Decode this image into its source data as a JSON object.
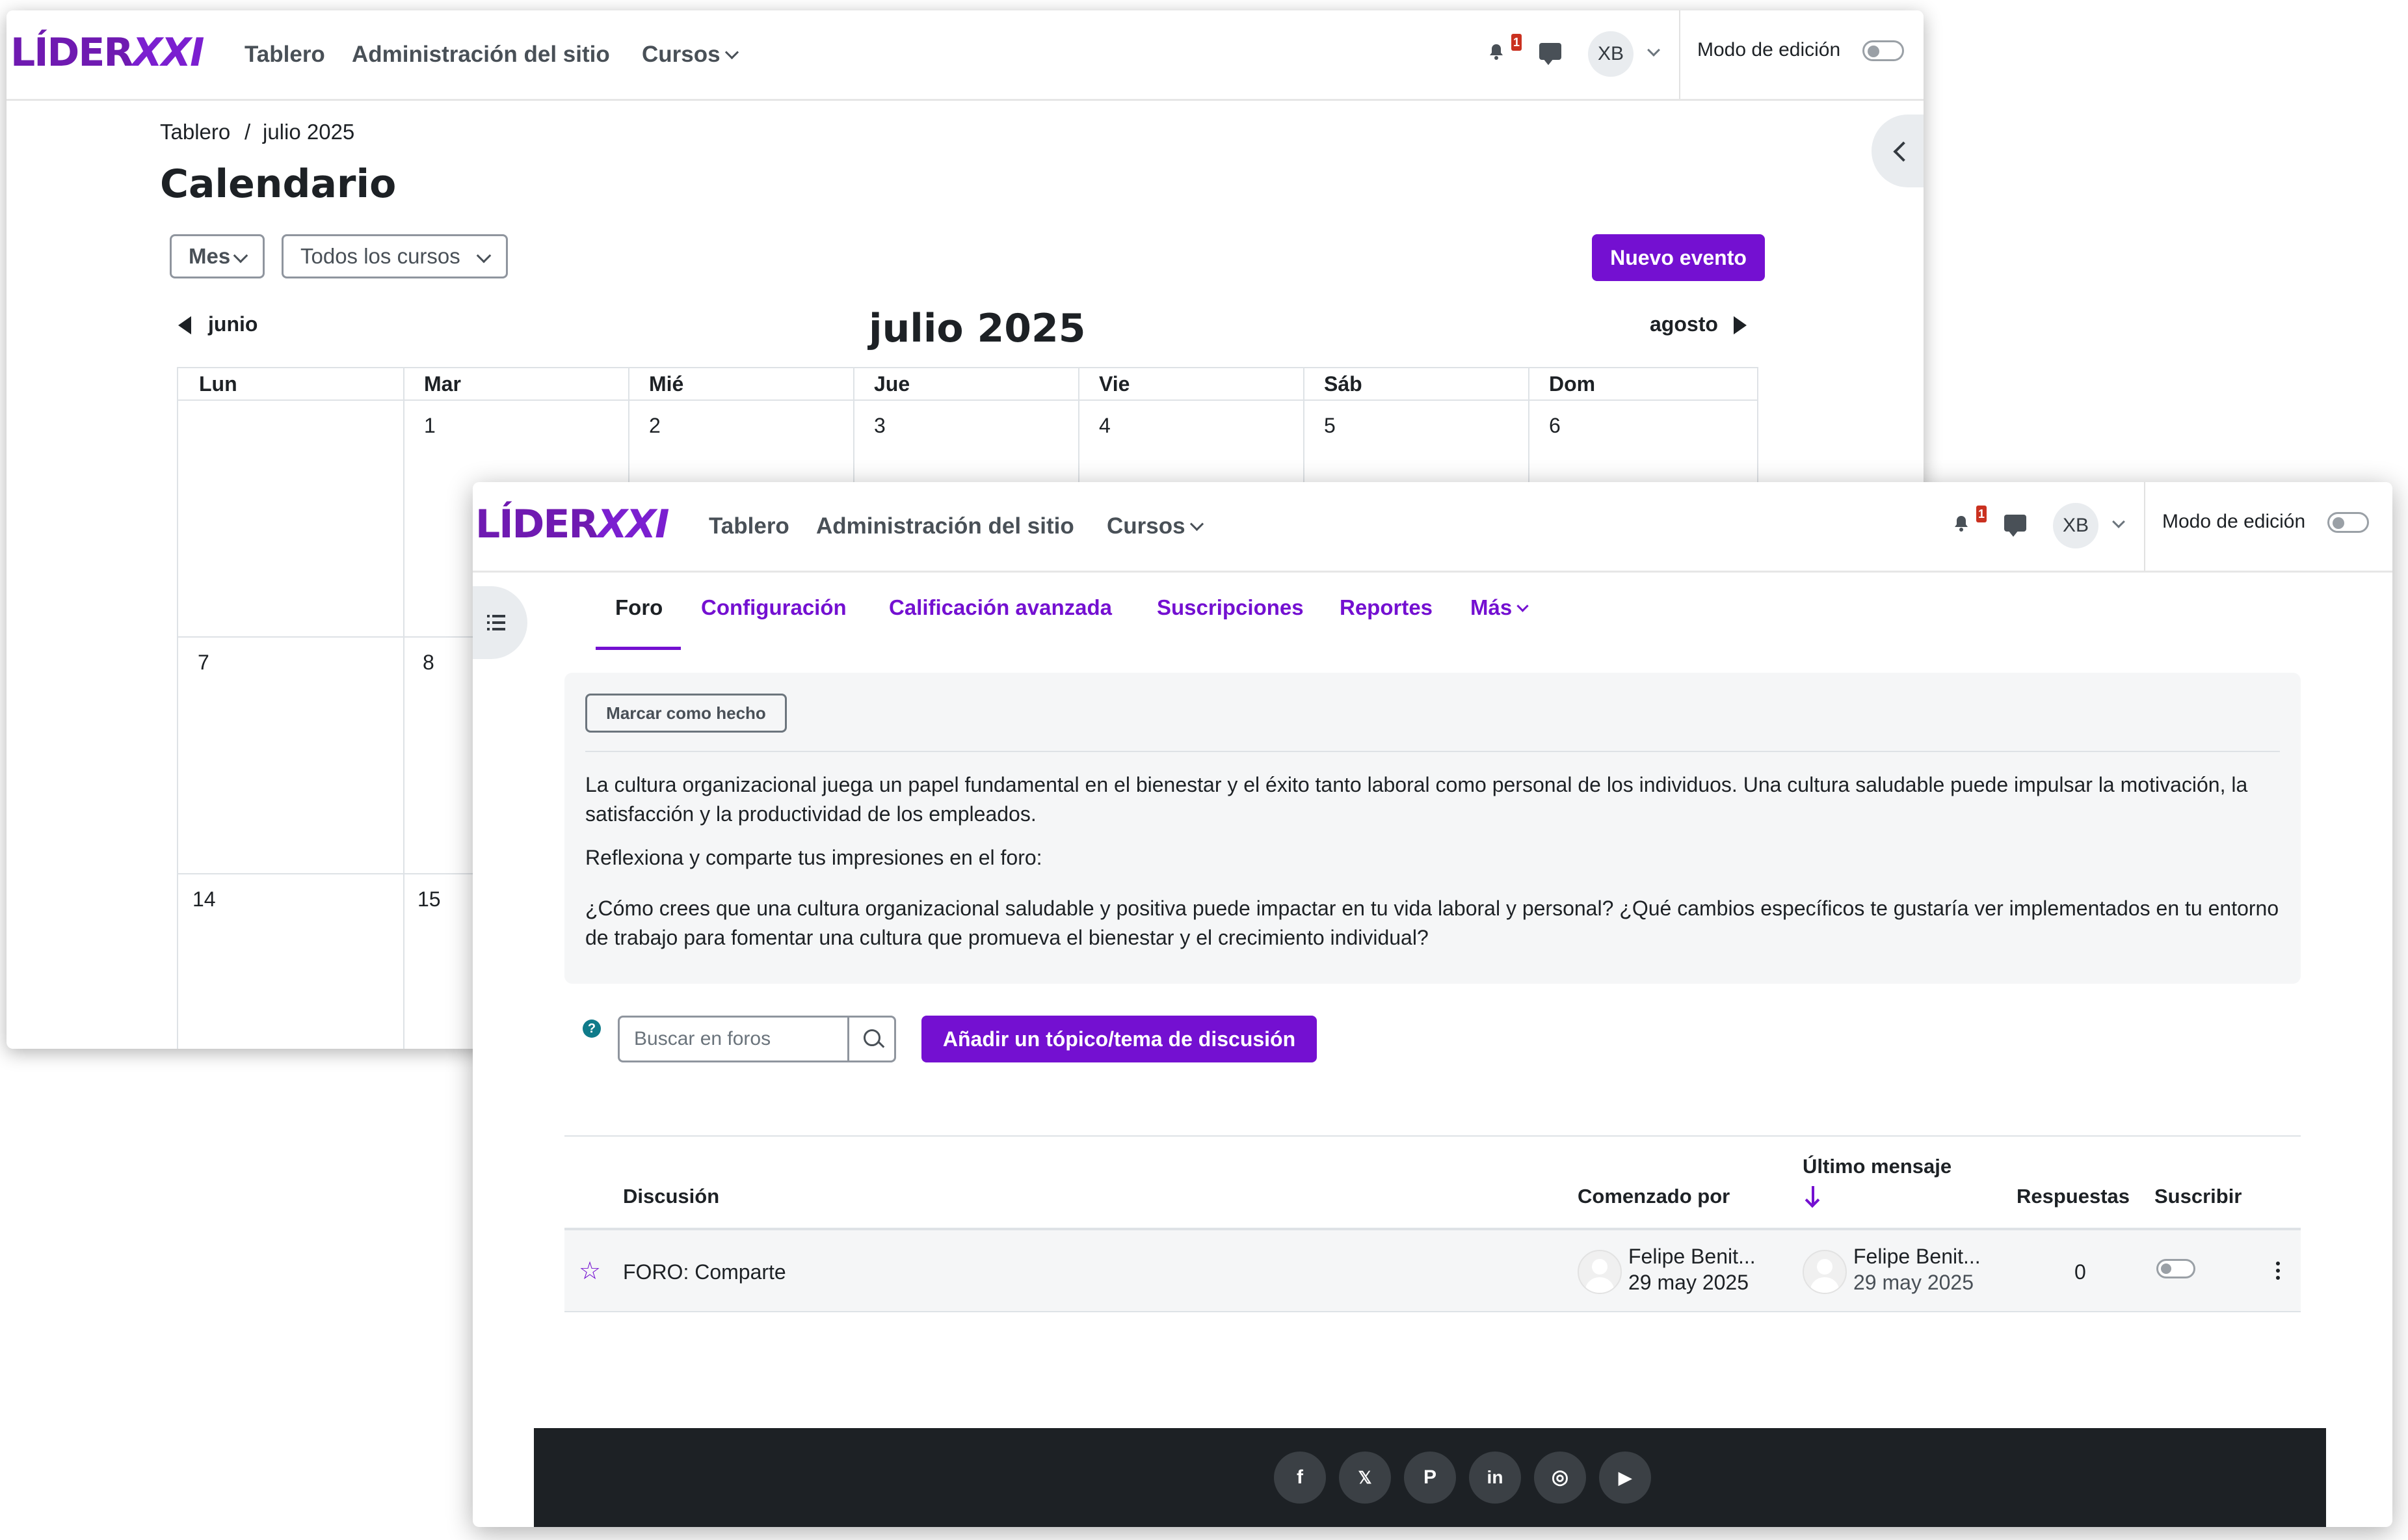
{
  "brand": {
    "logo_main": "LÍDER",
    "logo_accent": "XXI"
  },
  "navbar": {
    "links": [
      "Tablero",
      "Administración del sitio",
      "Cursos"
    ],
    "notification_count": "1",
    "user_initials": "XB",
    "edit_mode_label": "Modo de edición"
  },
  "calendar_page": {
    "breadcrumb": [
      "Tablero",
      "/",
      "julio 2025"
    ],
    "title": "Calendario",
    "view_select": "Mes",
    "course_select": "Todos los cursos",
    "new_event_label": "Nuevo evento",
    "prev_month": "junio",
    "current_month": "julio 2025",
    "next_month": "agosto",
    "weekdays": [
      "Lun",
      "Mar",
      "Mié",
      "Jue",
      "Vie",
      "Sáb",
      "Dom"
    ],
    "first_row_days": [
      "",
      "1",
      "2",
      "3",
      "4",
      "5",
      "6"
    ],
    "visible_days_col1": [
      "7",
      "14"
    ],
    "visible_days_col2": [
      "8",
      "15"
    ]
  },
  "forum_page": {
    "tabs": [
      "Foro",
      "Configuración",
      "Calificación avanzada",
      "Suscripciones",
      "Reportes",
      "Más"
    ],
    "active_tab": "Foro",
    "mark_done_label": "Marcar como hecho",
    "intro_paragraphs": [
      "La cultura organizacional juega un papel fundamental en el bienestar y el éxito tanto laboral como personal de los individuos. Una cultura saludable puede impulsar la motivación, la satisfacción y la productividad de los empleados.",
      "Reflexiona y comparte tus impresiones en el foro:",
      "¿Cómo crees que una cultura organizacional saludable y positiva puede impactar en tu vida laboral y personal? ¿Qué cambios específicos te gustaría ver implementados en tu entorno de trabajo para fomentar una cultura que promueva el bienestar y el crecimiento individual?"
    ],
    "help_glyph": "?",
    "search_placeholder": "Buscar en foros",
    "add_topic_label": "Añadir un tópico/tema de discusión",
    "table_headers": {
      "discussion": "Discusión",
      "started_by": "Comenzado por",
      "last_post": "Último mensaje",
      "replies": "Respuestas",
      "subscribe": "Suscribir"
    },
    "rows": [
      {
        "title": "FORO: Comparte",
        "started_by_name": "Felipe Benit...",
        "started_by_date": "29 may 2025",
        "last_post_name": "Felipe Benit...",
        "last_post_date": "29 may 2025",
        "replies": "0"
      }
    ]
  },
  "footer": {
    "social_icons": [
      "facebook-icon",
      "x-icon",
      "pinterest-icon",
      "linkedin-icon",
      "instagram-icon",
      "youtube-icon"
    ],
    "social_glyphs": [
      "f",
      "𝕏",
      "P",
      "in",
      "◎",
      "▶"
    ]
  },
  "colors": {
    "brand_purple": "#7410d1",
    "badge_red": "#ca3120",
    "footer_dark": "#1d2125"
  }
}
